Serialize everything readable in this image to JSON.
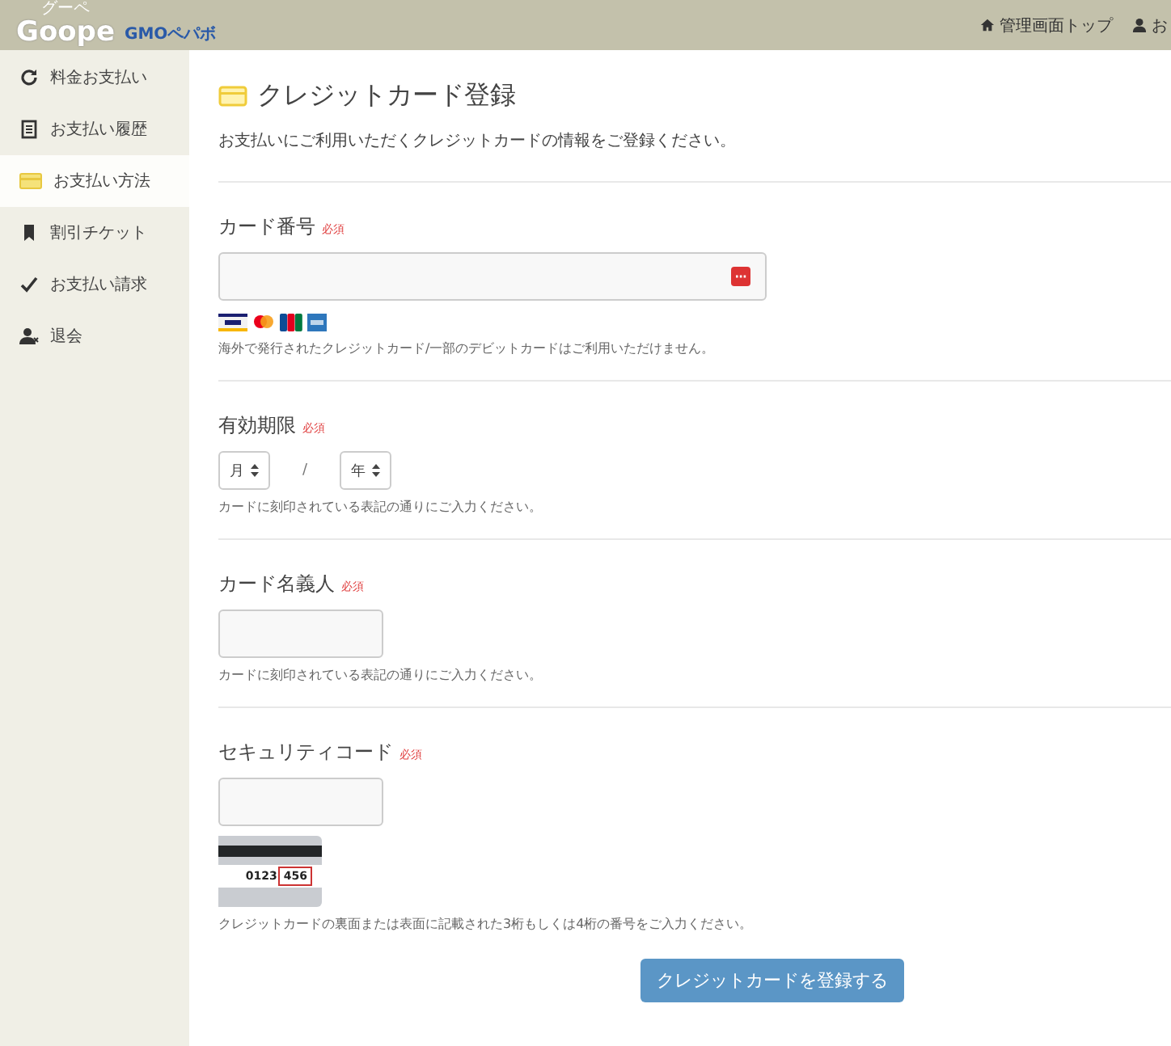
{
  "header": {
    "logo": {
      "ruby": "グーペ",
      "name": "Goope",
      "by": "GMOペパボ"
    },
    "nav": [
      {
        "label": "管理画面トップ"
      },
      {
        "label": "お"
      }
    ]
  },
  "sidebar": {
    "items": [
      {
        "label": "料金お支払い",
        "selected": false
      },
      {
        "label": "お支払い履歴",
        "selected": false
      },
      {
        "label": "お支払い方法",
        "selected": true
      },
      {
        "label": "割引チケット",
        "selected": false
      },
      {
        "label": "お支払い請求",
        "selected": false
      },
      {
        "label": "退会",
        "selected": false
      }
    ]
  },
  "page": {
    "title": "クレジットカード登録",
    "intro": "お支払いにご利用いただくクレジットカードの情報をご登録ください。"
  },
  "fields": [
    {
      "kind": "card",
      "label": "カード番号",
      "required": "必須",
      "hint": "海外で発行されたクレジットカード/一部のデビットカードはご利用いただけません。"
    },
    {
      "kind": "expiry",
      "label": "有効期限",
      "required": "必須",
      "month": "月",
      "separator": "/",
      "year": "年",
      "hint": "カードに刻印されている表記の通りにご入力ください。"
    },
    {
      "kind": "text",
      "label": "カード名義人",
      "required": "必須",
      "hint": "カードに刻印されている表記の通りにご入力ください。"
    },
    {
      "kind": "cvc",
      "label": "セキュリティコード",
      "required": "必須",
      "example_number": "0123",
      "example_code": "456",
      "hint": "クレジットカードの裏面または表面に記載された3桁もしくは4桁の番号をご入力ください。"
    }
  ],
  "submit": "クレジットカードを登録する"
}
